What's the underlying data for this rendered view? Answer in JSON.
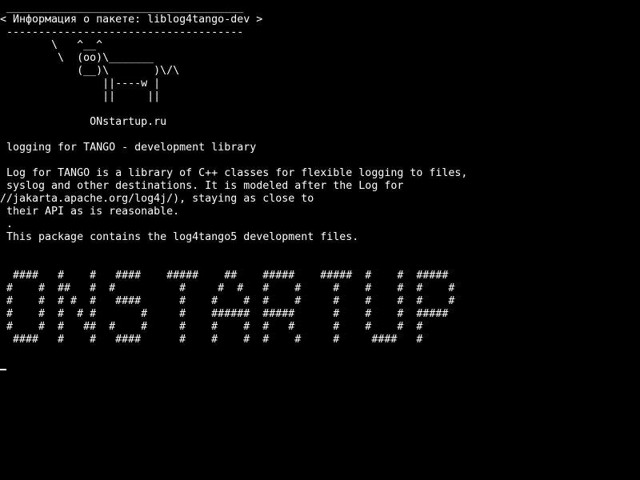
{
  "cowsay": {
    "border_top": " _____________________________________",
    "bubble": "< Информация о пакете: liblog4tango-dev >",
    "border_bottom": " -------------------------------------",
    "cow": [
      "        \\   ^__^",
      "         \\  (oo)\\_______",
      "            (__)\\       )\\/\\",
      "                ||----w |",
      "                ||     ||"
    ],
    "site": "              ONstartup.ru"
  },
  "package": {
    "summary": " logging for TANGO - development library",
    "description": [
      " Log for TANGO is a library of C++ classes for flexible logging to files,",
      " syslog and other destinations. It is modeled after the Log for",
      "//jakarta.apache.org/log4j/), staying as close to",
      " their API as is reasonable.",
      " .",
      " This package contains the log4tango5 development files."
    ]
  },
  "banner": [
    "  ####   #    #   ####    #####    ##    #####    #####  #    #  #####",
    " #    #  ##   #  #          #     #  #   #    #     #    #    #  #    #",
    " #    #  # #  #   ####      #    #    #  #    #     #    #    #  #    #",
    " #    #  #  # #       #     #    ######  #####      #    #    #  #####",
    " #    #  #   ##  #    #     #    #    #  #   #      #    #    #  #",
    "  ####   #    #   ####      #    #    #  #    #     #     ####   #"
  ]
}
